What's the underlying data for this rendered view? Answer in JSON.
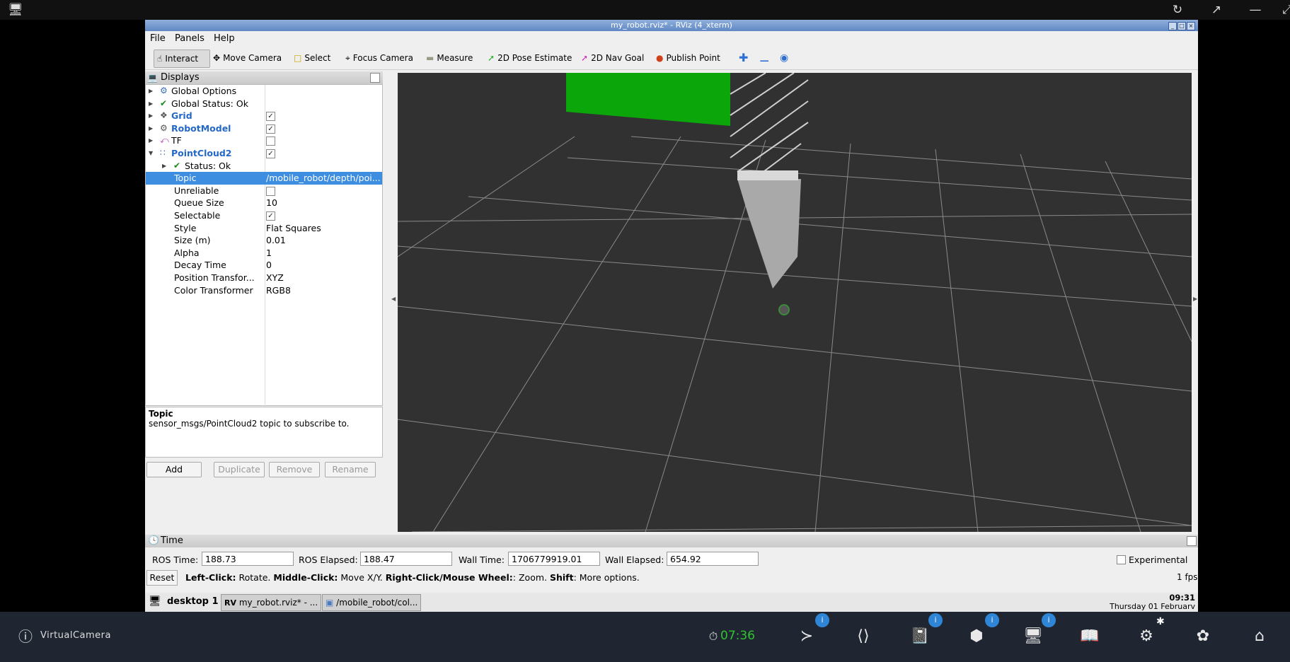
{
  "window": {
    "title": "my_robot.rviz* - RViz (4_xterm)"
  },
  "menu": [
    "File",
    "Panels",
    "Help"
  ],
  "toolbar": {
    "tools": [
      "Interact",
      "Move Camera",
      "Select",
      "Focus Camera",
      "Measure",
      "2D Pose Estimate",
      "2D Nav Goal",
      "Publish Point"
    ]
  },
  "displays": {
    "header": "Displays",
    "global_options": "Global Options",
    "global_status": "Global Status: Ok",
    "grid": "Grid",
    "robot_model": "RobotModel",
    "tf": "TF",
    "pointcloud2": "PointCloud2",
    "status": "Status: Ok",
    "properties": [
      {
        "name": "Topic",
        "value": "/mobile_robot/depth/poi..."
      },
      {
        "name": "Unreliable",
        "value": ""
      },
      {
        "name": "Queue Size",
        "value": "10"
      },
      {
        "name": "Selectable",
        "value": ""
      },
      {
        "name": "Style",
        "value": "Flat Squares"
      },
      {
        "name": "Size (m)",
        "value": "0.01"
      },
      {
        "name": "Alpha",
        "value": "1"
      },
      {
        "name": "Decay Time",
        "value": "0"
      },
      {
        "name": "Position Transfor...",
        "value": "XYZ"
      },
      {
        "name": "Color Transformer",
        "value": "RGB8"
      }
    ],
    "desc_title": "Topic",
    "desc_text": "sensor_msgs/PointCloud2 topic to subscribe to.",
    "buttons": {
      "add": "Add",
      "duplicate": "Duplicate",
      "remove": "Remove",
      "rename": "Rename"
    }
  },
  "time": {
    "header": "Time",
    "ros_time_label": "ROS Time:",
    "ros_time": "188.73",
    "ros_elapsed_label": "ROS Elapsed:",
    "ros_elapsed": "188.47",
    "wall_time_label": "Wall Time:",
    "wall_time": "1706779919.01",
    "wall_elapsed_label": "Wall Elapsed:",
    "wall_elapsed": "654.92",
    "experimental": "Experimental",
    "reset": "Reset",
    "help_left_b": "Left-Click:",
    "help_left": " Rotate. ",
    "help_mid_b": "Middle-Click:",
    "help_mid": " Move X/Y. ",
    "help_right_b": "Right-Click/Mouse Wheel:",
    "help_right": ": Zoom. ",
    "help_shift_b": "Shift",
    "help_shift": ": More options.",
    "fps": "1 fps"
  },
  "taskbar": {
    "desktop": "desktop 1",
    "task1": "my_robot.rviz* - ...",
    "task2": "/mobile_robot/col...",
    "clock_time": "09:31",
    "clock_date": "Thursday 01 Februarv"
  },
  "dock": {
    "app_name": "VirtualCamera",
    "timer": "07:36",
    "badge": "i"
  }
}
